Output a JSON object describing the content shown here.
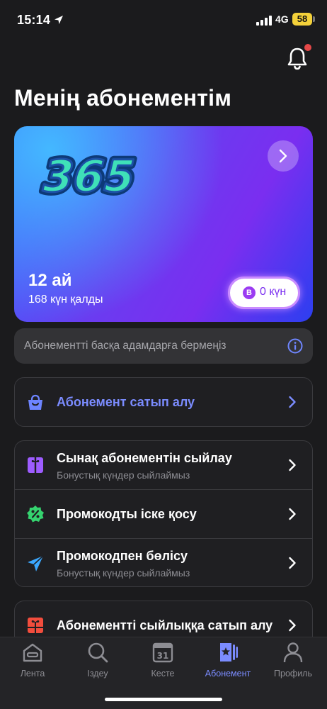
{
  "status_bar": {
    "time": "15:14",
    "network": "4G",
    "battery": "58"
  },
  "header": {
    "title": "Менің абонементім"
  },
  "subscription_card": {
    "period": "12 ай",
    "days_left": "168 күн қалды",
    "bonus_badge": "B",
    "bonus_value": "0 күн"
  },
  "notice": {
    "text": "Абонементті басқа адамдарға бермеңіз"
  },
  "menu": {
    "buy": {
      "title": "Абонемент сатып алу"
    },
    "gift_trial": {
      "title": "Сынақ абонементін сыйлау",
      "subtitle": "Бонустық күндер сыйлаймыз"
    },
    "activate_promo": {
      "title": "Промокодты іске қосу"
    },
    "share_promo": {
      "title": "Промокодпен бөлісу",
      "subtitle": "Бонустық күндер сыйлаймыз"
    },
    "buy_gift": {
      "title": "Абонементті сыйлыққа сатып алу"
    }
  },
  "tabs": [
    {
      "label": "Лента"
    },
    {
      "label": "Іздеу"
    },
    {
      "label": "Кесте",
      "day": "31"
    },
    {
      "label": "Абонемент"
    },
    {
      "label": "Профиль"
    }
  ],
  "colors": {
    "accent": "#7b8cff",
    "background": "#1b1b1d",
    "notification_dot": "#e54848"
  }
}
